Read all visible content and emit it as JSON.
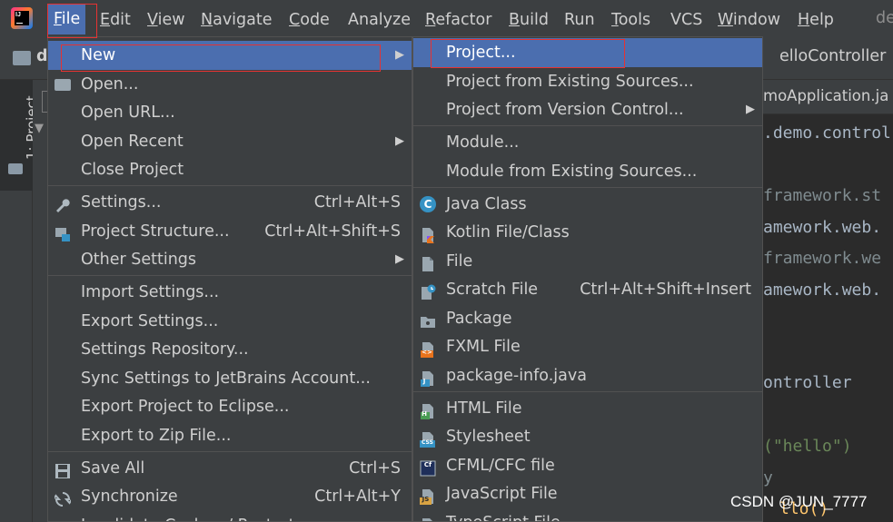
{
  "menubar": {
    "items": [
      {
        "label": "File",
        "u": "F",
        "rest": "ile"
      },
      {
        "label": "Edit",
        "u": "E",
        "rest": "dit"
      },
      {
        "label": "View",
        "u": "V",
        "rest": "iew"
      },
      {
        "label": "Navigate",
        "u": "N",
        "rest": "avigate"
      },
      {
        "label": "Code",
        "u": "C",
        "rest": "ode"
      },
      {
        "label": "Analyze",
        "u": "",
        "rest": "Analyze"
      },
      {
        "label": "Refactor",
        "u": "R",
        "rest": "efactor"
      },
      {
        "label": "Build",
        "u": "B",
        "rest": "uild"
      },
      {
        "label": "Run",
        "u": "",
        "rest": "Run"
      },
      {
        "label": "Tools",
        "u": "T",
        "rest": "ools"
      },
      {
        "label": "VCS",
        "u": "",
        "rest": "VCS"
      },
      {
        "label": "Window",
        "u": "W",
        "rest": "indow"
      },
      {
        "label": "Help",
        "u": "H",
        "rest": "elp"
      }
    ],
    "title_fragment": "de",
    "logo_text": "IJ"
  },
  "nav": {
    "folder_label": "d"
  },
  "tool_window": {
    "project_tab": "1: Project"
  },
  "editor": {
    "tab_hello": "elloController",
    "tab_demoapp": "moApplication.ja",
    "lines": [
      ".demo.control",
      "framework.st",
      "amework.web.",
      "framework.we",
      "amework.web.",
      "ontroller",
      "(\"hello\")",
      "y",
      "llo()"
    ]
  },
  "file_menu": {
    "items": [
      {
        "label": "New",
        "has_submenu": true
      },
      {
        "label": "Open...",
        "icon": "folder-open-icon"
      },
      {
        "label": "Open URL..."
      },
      {
        "label": "Open Recent",
        "has_submenu": true
      },
      {
        "label": "Close Project"
      },
      {
        "label": "Settings...",
        "shortcut": "Ctrl+Alt+S",
        "icon": "wrench-icon"
      },
      {
        "label": "Project Structure...",
        "shortcut": "Ctrl+Alt+Shift+S",
        "icon": "project-structure-icon"
      },
      {
        "label": "Other Settings",
        "has_submenu": true
      },
      {
        "label": "Import Settings..."
      },
      {
        "label": "Export Settings..."
      },
      {
        "label": "Settings Repository..."
      },
      {
        "label": "Sync Settings to JetBrains Account..."
      },
      {
        "label": "Export Project to Eclipse..."
      },
      {
        "label": "Export to Zip File..."
      },
      {
        "label": "Save All",
        "shortcut": "Ctrl+S",
        "icon": "save-icon"
      },
      {
        "label": "Synchronize",
        "shortcut": "Ctrl+Alt+Y",
        "icon": "sync-icon"
      },
      {
        "label": "Invalidate Caches / Restart..."
      }
    ]
  },
  "new_submenu": {
    "items": [
      {
        "label": "Project..."
      },
      {
        "label": "Project from Existing Sources..."
      },
      {
        "label": "Project from Version Control...",
        "has_submenu": true
      },
      {
        "label": "Module..."
      },
      {
        "label": "Module from Existing Sources..."
      },
      {
        "label": "Java Class",
        "icon": "java-class-icon",
        "badge": "C"
      },
      {
        "label": "Kotlin File/Class",
        "icon": "kotlin-file-icon"
      },
      {
        "label": "File",
        "icon": "file-icon"
      },
      {
        "label": "Scratch File",
        "shortcut": "Ctrl+Alt+Shift+Insert",
        "icon": "scratch-file-icon"
      },
      {
        "label": "Package",
        "icon": "package-icon"
      },
      {
        "label": "FXML File",
        "icon": "fxml-file-icon",
        "badge": "<>"
      },
      {
        "label": "package-info.java",
        "icon": "package-info-icon",
        "badge": "J"
      },
      {
        "label": "HTML File",
        "icon": "html-file-icon",
        "badge": "H"
      },
      {
        "label": "Stylesheet",
        "icon": "stylesheet-icon",
        "badge": "CSS"
      },
      {
        "label": "CFML/CFC file",
        "icon": "cfml-file-icon",
        "badge": "Cf"
      },
      {
        "label": "JavaScript File",
        "icon": "javascript-file-icon",
        "badge": "JS"
      },
      {
        "label": "TypeScript File",
        "icon": "typescript-file-icon"
      }
    ]
  },
  "watermark": "CSDN @JUN_7777",
  "colors": {
    "menu_bg": "#3c3f41",
    "highlight": "#4b6eaf",
    "editor_bg": "#2b2b2b",
    "annotation_box": "#e63232"
  }
}
